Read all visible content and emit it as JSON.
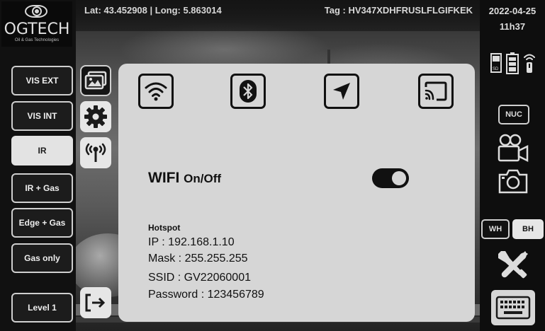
{
  "header": {
    "coords": "Lat: 43.452908 | Long: 5.863014",
    "tag": "Tag : HV347XDHFRUSLFLGIFKEK"
  },
  "logo": {
    "brand": "OGTECH",
    "sub": "Oil & Gas Technologies"
  },
  "status": {
    "date": "2022-04-25",
    "time": "11h37"
  },
  "modes": [
    {
      "label": "VIS EXT",
      "active": false
    },
    {
      "label": "VIS INT",
      "active": false
    },
    {
      "label": "IR",
      "active": true
    },
    {
      "label": "IR + Gas",
      "active": false
    },
    {
      "label": "Edge + Gas",
      "active": false
    },
    {
      "label": "Gas only",
      "active": false
    }
  ],
  "level": {
    "label": "Level 1"
  },
  "panel": {
    "tabs": [
      "wifi-icon",
      "bluetooth-icon",
      "location-arrow-icon",
      "cast-icon"
    ],
    "wifi_title": "WIFI",
    "wifi_suffix": "On/Off",
    "wifi_enabled": true,
    "hotspot_label": "Hotspot",
    "ip": "IP : 192.168.1.10",
    "mask": "Mask : 255.255.255",
    "ssid": "SSID : GV22060001",
    "password": "Password : 123456789"
  },
  "right": {
    "nuc_label": "NUC",
    "wh_label": "WH",
    "bh_label": "BH"
  },
  "colors": {
    "panel_bg": "#d6d6d6",
    "active_button_bg": "#e3e3e3",
    "background": "#111111"
  }
}
